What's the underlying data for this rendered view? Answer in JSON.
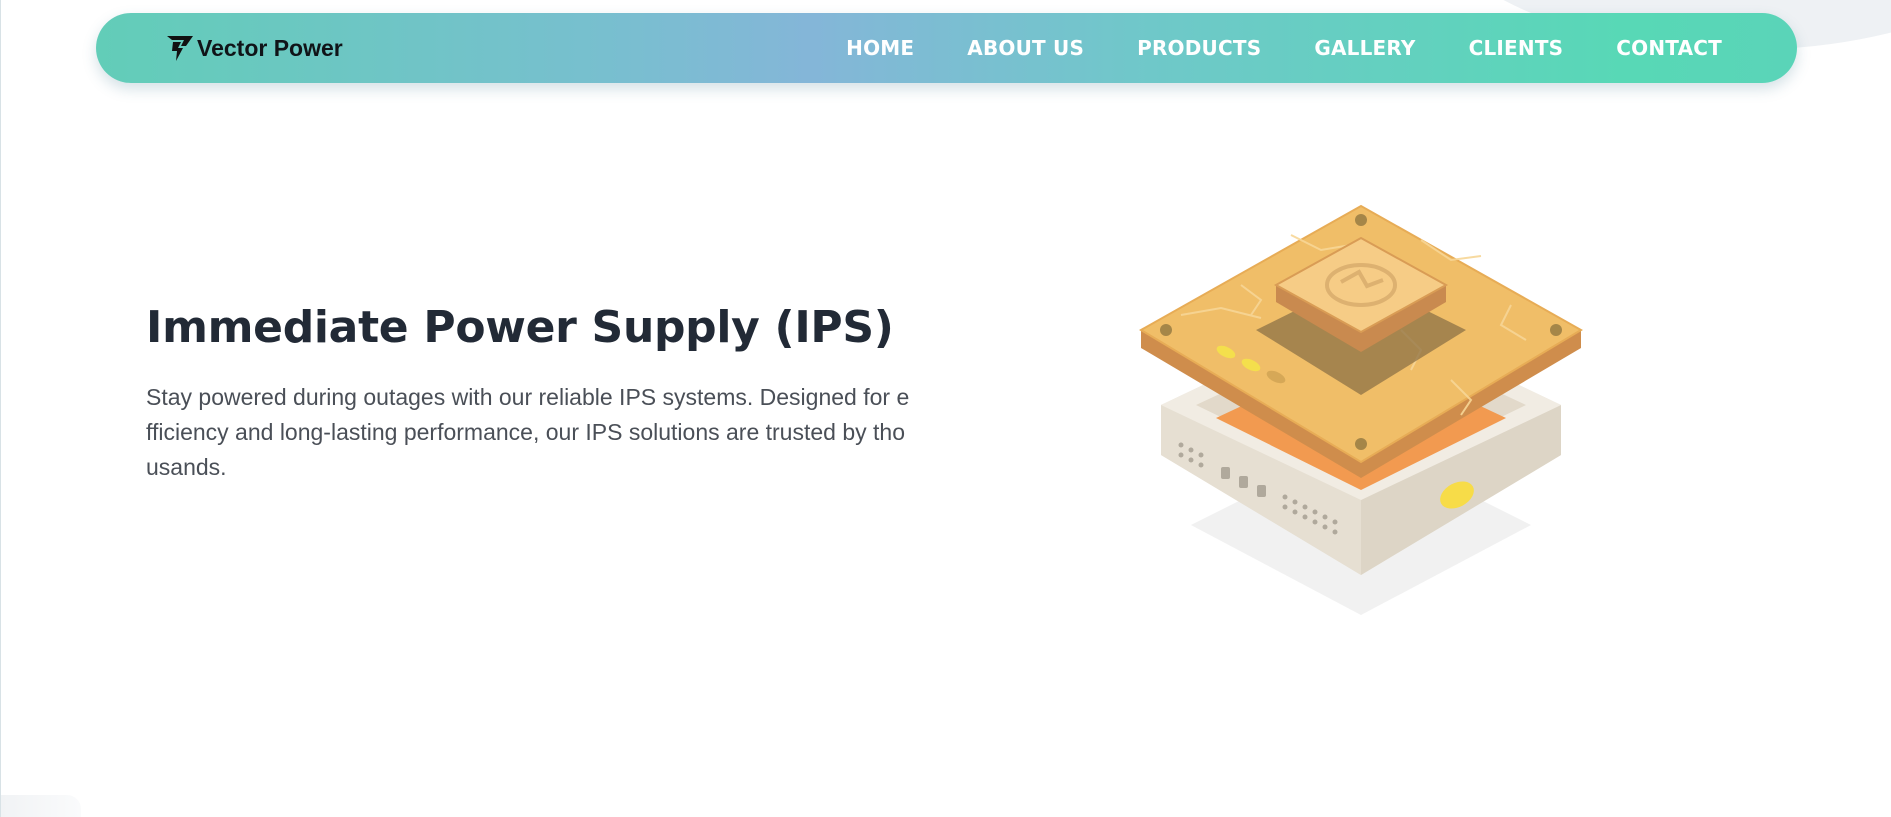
{
  "brand": {
    "name": "Vector Power",
    "logo_icon": "vector-lightning-icon"
  },
  "nav": {
    "items": [
      {
        "label": "HOME"
      },
      {
        "label": "ABOUT US"
      },
      {
        "label": "PRODUCTS"
      },
      {
        "label": "GALLERY"
      },
      {
        "label": "CLIENTS"
      },
      {
        "label": "CONTACT"
      }
    ]
  },
  "hero": {
    "title": "Immediate Power Supply (IPS)",
    "description": "Stay powered during outages with our reliable IPS systems. Designed for efficiency and long-lasting performance, our IPS solutions are trusted by thousands.",
    "illustration_icon": "isometric-power-unit-icon"
  },
  "colors": {
    "nav_gradient_start": "#62cdb8",
    "nav_gradient_mid": "#84b6d8",
    "nav_gradient_end": "#58d8b6",
    "title": "#222a36",
    "body_text": "#4a4f57",
    "accent_orange": "#f29a50",
    "accent_gold": "#f0be68"
  }
}
